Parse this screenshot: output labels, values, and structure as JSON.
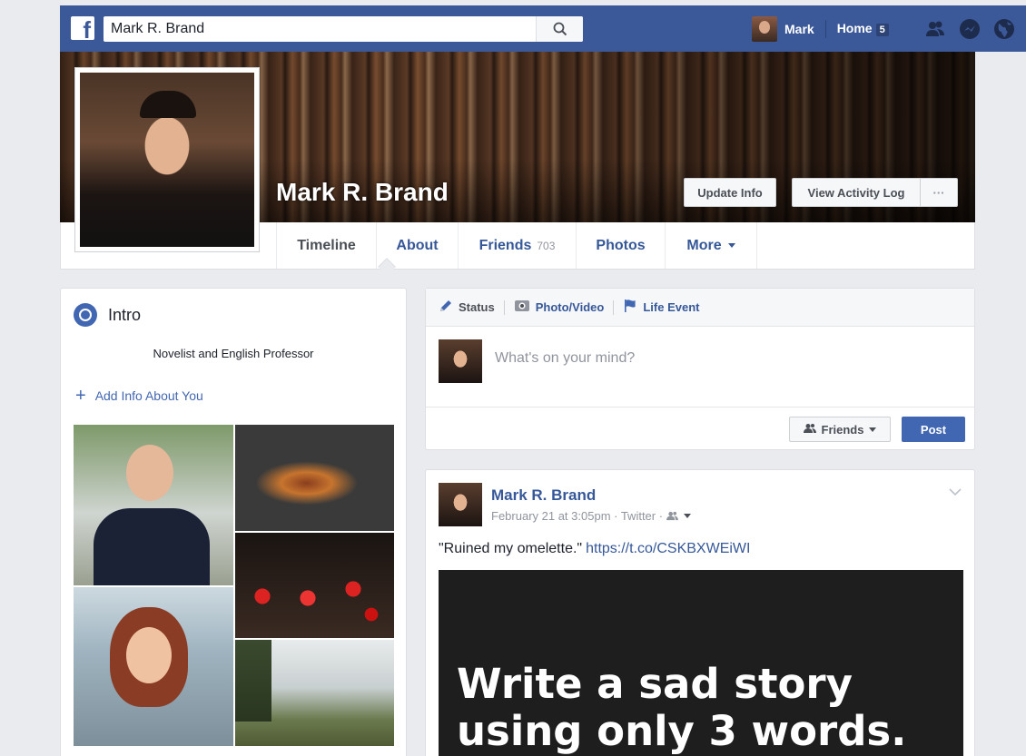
{
  "nav": {
    "logo_letter": "f",
    "search_value": "Mark R. Brand",
    "user_name": "Mark",
    "home_label": "Home",
    "home_count": "5",
    "icons": [
      "friends-icon",
      "messenger-icon",
      "globe-icon"
    ]
  },
  "cover": {
    "name": "Mark R. Brand",
    "update_info_label": "Update Info",
    "activity_log_label": "View Activity Log",
    "more_label": "···"
  },
  "tabs": {
    "timeline": "Timeline",
    "about": "About",
    "friends": "Friends",
    "friends_count": "703",
    "photos": "Photos",
    "more": "More"
  },
  "intro": {
    "title": "Intro",
    "bio": "Novelist and English Professor",
    "add_info": "Add Info About You"
  },
  "composer": {
    "tab_status": "Status",
    "tab_photo": "Photo/Video",
    "tab_life": "Life Event",
    "placeholder": "What's on your mind?",
    "audience_label": "Friends",
    "post_label": "Post"
  },
  "post": {
    "author": "Mark R. Brand",
    "meta": "February 21 at 3:05pm · Twitter ·",
    "text": "\"Ruined my omelette.\"",
    "link": "https://t.co/CSKBXWEiWI",
    "image_line1": "Write a sad story",
    "image_line2": "using only 3 words."
  },
  "colors": {
    "brand_blue": "#3b5998",
    "link_blue": "#365899",
    "button_blue": "#4267b2",
    "page_bg": "#e9ebee"
  }
}
